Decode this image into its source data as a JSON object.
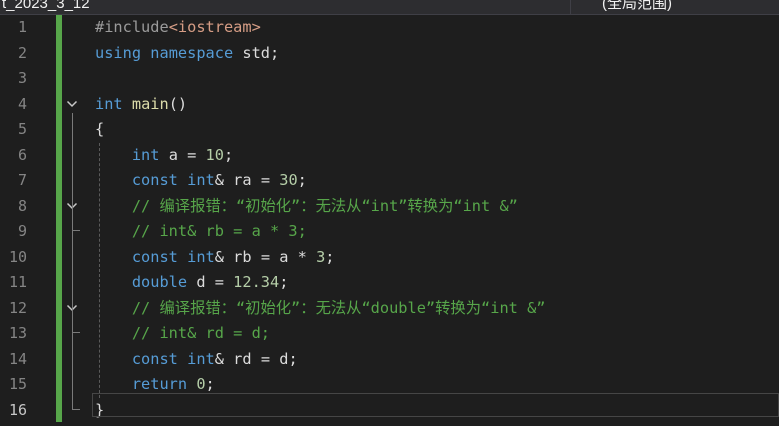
{
  "window": {
    "left_tab_title": "t_2023_3_12",
    "right_tab_title": "(全局范围)"
  },
  "editor": {
    "current_line": 16,
    "lines": [
      {
        "n": "1",
        "tokens": [
          {
            "t": "#include",
            "c": "pp"
          },
          {
            "t": "<iostream>",
            "c": "hdr"
          }
        ]
      },
      {
        "n": "2",
        "tokens": [
          {
            "t": "using",
            "c": "kw"
          },
          {
            "t": " ",
            "c": "id"
          },
          {
            "t": "namespace",
            "c": "kw"
          },
          {
            "t": " std;",
            "c": "id"
          }
        ]
      },
      {
        "n": "3",
        "tokens": []
      },
      {
        "n": "4",
        "tokens": [
          {
            "t": "int",
            "c": "kw"
          },
          {
            "t": " ",
            "c": "id"
          },
          {
            "t": "main",
            "c": "fn"
          },
          {
            "t": "()",
            "c": "id"
          }
        ]
      },
      {
        "n": "5",
        "tokens": [
          {
            "t": "{",
            "c": "id"
          }
        ]
      },
      {
        "n": "6",
        "tokens": [
          {
            "t": "    ",
            "c": "id"
          },
          {
            "t": "int",
            "c": "kw"
          },
          {
            "t": " a = ",
            "c": "id"
          },
          {
            "t": "10",
            "c": "num"
          },
          {
            "t": ";",
            "c": "id"
          }
        ]
      },
      {
        "n": "7",
        "tokens": [
          {
            "t": "    ",
            "c": "id"
          },
          {
            "t": "const",
            "c": "kw"
          },
          {
            "t": " ",
            "c": "id"
          },
          {
            "t": "int",
            "c": "kw"
          },
          {
            "t": "& ra = ",
            "c": "id"
          },
          {
            "t": "30",
            "c": "num"
          },
          {
            "t": ";",
            "c": "id"
          }
        ]
      },
      {
        "n": "8",
        "tokens": [
          {
            "t": "    ",
            "c": "id"
          },
          {
            "t": "// 编译报错：“初始化”：无法从“int”转换为“int &”",
            "c": "cm"
          }
        ]
      },
      {
        "n": "9",
        "tokens": [
          {
            "t": "    ",
            "c": "id"
          },
          {
            "t": "// int& rb = a * 3;",
            "c": "cm"
          }
        ]
      },
      {
        "n": "10",
        "tokens": [
          {
            "t": "    ",
            "c": "id"
          },
          {
            "t": "const",
            "c": "kw"
          },
          {
            "t": " ",
            "c": "id"
          },
          {
            "t": "int",
            "c": "kw"
          },
          {
            "t": "& rb = a * ",
            "c": "id"
          },
          {
            "t": "3",
            "c": "num"
          },
          {
            "t": ";",
            "c": "id"
          }
        ]
      },
      {
        "n": "11",
        "tokens": [
          {
            "t": "    ",
            "c": "id"
          },
          {
            "t": "double",
            "c": "kw"
          },
          {
            "t": " d = ",
            "c": "id"
          },
          {
            "t": "12.34",
            "c": "num"
          },
          {
            "t": ";",
            "c": "id"
          }
        ]
      },
      {
        "n": "12",
        "tokens": [
          {
            "t": "    ",
            "c": "id"
          },
          {
            "t": "// 编译报错：“初始化”：无法从“double”转换为“int &”",
            "c": "cm"
          }
        ]
      },
      {
        "n": "13",
        "tokens": [
          {
            "t": "    ",
            "c": "id"
          },
          {
            "t": "// int& rd = d;",
            "c": "cm"
          }
        ]
      },
      {
        "n": "14",
        "tokens": [
          {
            "t": "    ",
            "c": "id"
          },
          {
            "t": "const",
            "c": "kw"
          },
          {
            "t": " ",
            "c": "id"
          },
          {
            "t": "int",
            "c": "kw"
          },
          {
            "t": "& rd = d;",
            "c": "id"
          }
        ]
      },
      {
        "n": "15",
        "tokens": [
          {
            "t": "    ",
            "c": "id"
          },
          {
            "t": "return",
            "c": "kw"
          },
          {
            "t": " ",
            "c": "id"
          },
          {
            "t": "0",
            "c": "num"
          },
          {
            "t": ";",
            "c": "id"
          }
        ]
      },
      {
        "n": "16",
        "tokens": [
          {
            "t": "}",
            "c": "id"
          }
        ]
      }
    ],
    "fold_lines": [
      4,
      8,
      12
    ]
  },
  "colors": {
    "background": "#1e1e1e",
    "keyword": "#569cd6",
    "comment": "#57a64a",
    "number": "#b5cea8",
    "changed_bar": "#57a64a"
  }
}
